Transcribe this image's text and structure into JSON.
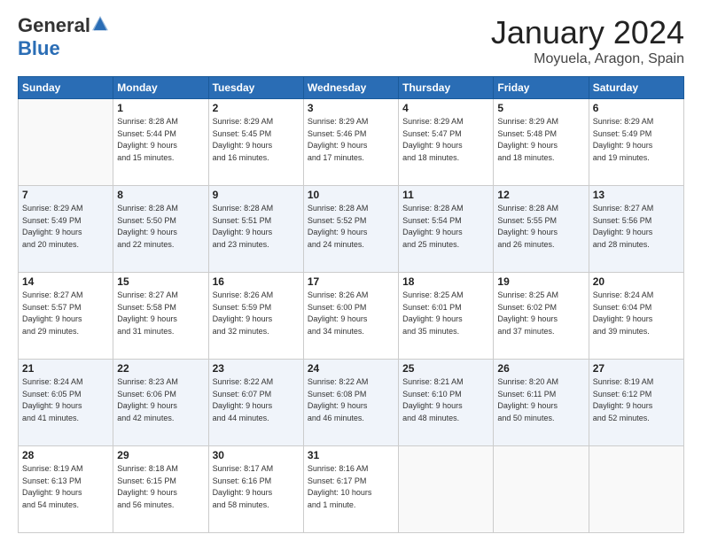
{
  "logo": {
    "general": "General",
    "blue": "Blue"
  },
  "title": "January 2024",
  "location": "Moyuela, Aragon, Spain",
  "weekdays": [
    "Sunday",
    "Monday",
    "Tuesday",
    "Wednesday",
    "Thursday",
    "Friday",
    "Saturday"
  ],
  "weeks": [
    [
      {
        "day": "",
        "info": ""
      },
      {
        "day": "1",
        "info": "Sunrise: 8:28 AM\nSunset: 5:44 PM\nDaylight: 9 hours\nand 15 minutes."
      },
      {
        "day": "2",
        "info": "Sunrise: 8:29 AM\nSunset: 5:45 PM\nDaylight: 9 hours\nand 16 minutes."
      },
      {
        "day": "3",
        "info": "Sunrise: 8:29 AM\nSunset: 5:46 PM\nDaylight: 9 hours\nand 17 minutes."
      },
      {
        "day": "4",
        "info": "Sunrise: 8:29 AM\nSunset: 5:47 PM\nDaylight: 9 hours\nand 18 minutes."
      },
      {
        "day": "5",
        "info": "Sunrise: 8:29 AM\nSunset: 5:48 PM\nDaylight: 9 hours\nand 18 minutes."
      },
      {
        "day": "6",
        "info": "Sunrise: 8:29 AM\nSunset: 5:49 PM\nDaylight: 9 hours\nand 19 minutes."
      }
    ],
    [
      {
        "day": "7",
        "info": "Sunrise: 8:29 AM\nSunset: 5:49 PM\nDaylight: 9 hours\nand 20 minutes."
      },
      {
        "day": "8",
        "info": "Sunrise: 8:28 AM\nSunset: 5:50 PM\nDaylight: 9 hours\nand 22 minutes."
      },
      {
        "day": "9",
        "info": "Sunrise: 8:28 AM\nSunset: 5:51 PM\nDaylight: 9 hours\nand 23 minutes."
      },
      {
        "day": "10",
        "info": "Sunrise: 8:28 AM\nSunset: 5:52 PM\nDaylight: 9 hours\nand 24 minutes."
      },
      {
        "day": "11",
        "info": "Sunrise: 8:28 AM\nSunset: 5:54 PM\nDaylight: 9 hours\nand 25 minutes."
      },
      {
        "day": "12",
        "info": "Sunrise: 8:28 AM\nSunset: 5:55 PM\nDaylight: 9 hours\nand 26 minutes."
      },
      {
        "day": "13",
        "info": "Sunrise: 8:27 AM\nSunset: 5:56 PM\nDaylight: 9 hours\nand 28 minutes."
      }
    ],
    [
      {
        "day": "14",
        "info": "Sunrise: 8:27 AM\nSunset: 5:57 PM\nDaylight: 9 hours\nand 29 minutes."
      },
      {
        "day": "15",
        "info": "Sunrise: 8:27 AM\nSunset: 5:58 PM\nDaylight: 9 hours\nand 31 minutes."
      },
      {
        "day": "16",
        "info": "Sunrise: 8:26 AM\nSunset: 5:59 PM\nDaylight: 9 hours\nand 32 minutes."
      },
      {
        "day": "17",
        "info": "Sunrise: 8:26 AM\nSunset: 6:00 PM\nDaylight: 9 hours\nand 34 minutes."
      },
      {
        "day": "18",
        "info": "Sunrise: 8:25 AM\nSunset: 6:01 PM\nDaylight: 9 hours\nand 35 minutes."
      },
      {
        "day": "19",
        "info": "Sunrise: 8:25 AM\nSunset: 6:02 PM\nDaylight: 9 hours\nand 37 minutes."
      },
      {
        "day": "20",
        "info": "Sunrise: 8:24 AM\nSunset: 6:04 PM\nDaylight: 9 hours\nand 39 minutes."
      }
    ],
    [
      {
        "day": "21",
        "info": "Sunrise: 8:24 AM\nSunset: 6:05 PM\nDaylight: 9 hours\nand 41 minutes."
      },
      {
        "day": "22",
        "info": "Sunrise: 8:23 AM\nSunset: 6:06 PM\nDaylight: 9 hours\nand 42 minutes."
      },
      {
        "day": "23",
        "info": "Sunrise: 8:22 AM\nSunset: 6:07 PM\nDaylight: 9 hours\nand 44 minutes."
      },
      {
        "day": "24",
        "info": "Sunrise: 8:22 AM\nSunset: 6:08 PM\nDaylight: 9 hours\nand 46 minutes."
      },
      {
        "day": "25",
        "info": "Sunrise: 8:21 AM\nSunset: 6:10 PM\nDaylight: 9 hours\nand 48 minutes."
      },
      {
        "day": "26",
        "info": "Sunrise: 8:20 AM\nSunset: 6:11 PM\nDaylight: 9 hours\nand 50 minutes."
      },
      {
        "day": "27",
        "info": "Sunrise: 8:19 AM\nSunset: 6:12 PM\nDaylight: 9 hours\nand 52 minutes."
      }
    ],
    [
      {
        "day": "28",
        "info": "Sunrise: 8:19 AM\nSunset: 6:13 PM\nDaylight: 9 hours\nand 54 minutes."
      },
      {
        "day": "29",
        "info": "Sunrise: 8:18 AM\nSunset: 6:15 PM\nDaylight: 9 hours\nand 56 minutes."
      },
      {
        "day": "30",
        "info": "Sunrise: 8:17 AM\nSunset: 6:16 PM\nDaylight: 9 hours\nand 58 minutes."
      },
      {
        "day": "31",
        "info": "Sunrise: 8:16 AM\nSunset: 6:17 PM\nDaylight: 10 hours\nand 1 minute."
      },
      {
        "day": "",
        "info": ""
      },
      {
        "day": "",
        "info": ""
      },
      {
        "day": "",
        "info": ""
      }
    ]
  ]
}
